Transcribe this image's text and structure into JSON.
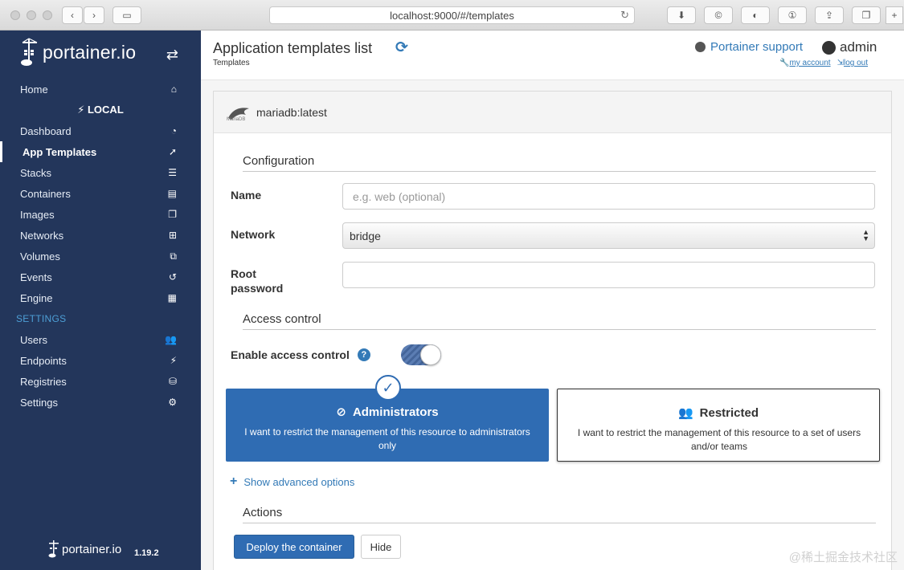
{
  "browser": {
    "url": "localhost:9000/#/templates"
  },
  "sidebar": {
    "logo_text": "portainer.io",
    "home_label": "Home",
    "endpoint_header": "LOCAL",
    "items": [
      {
        "label": "Dashboard",
        "icon": "tachometer-icon"
      },
      {
        "label": "App Templates",
        "icon": "rocket-icon",
        "active": true
      },
      {
        "label": "Stacks",
        "icon": "list-icon"
      },
      {
        "label": "Containers",
        "icon": "server-icon"
      },
      {
        "label": "Images",
        "icon": "clone-icon"
      },
      {
        "label": "Networks",
        "icon": "sitemap-icon"
      },
      {
        "label": "Volumes",
        "icon": "cubes-icon"
      },
      {
        "label": "Events",
        "icon": "history-icon"
      },
      {
        "label": "Engine",
        "icon": "th-icon"
      }
    ],
    "settings_header": "SETTINGS",
    "settings_items": [
      {
        "label": "Users",
        "icon": "users-icon"
      },
      {
        "label": "Endpoints",
        "icon": "plug-icon"
      },
      {
        "label": "Registries",
        "icon": "database-icon"
      },
      {
        "label": "Settings",
        "icon": "cogs-icon"
      }
    ],
    "footer_logo": "portainer.io",
    "version": "1.19.2"
  },
  "header": {
    "title": "Application templates list",
    "breadcrumb": "Templates",
    "support_label": "Portainer support",
    "username": "admin",
    "my_account": "my account",
    "log_out": "log out"
  },
  "template": {
    "name": "mariadb:latest",
    "logo_caption": "MariaDB"
  },
  "form": {
    "config_section": "Configuration",
    "name_label": "Name",
    "name_placeholder": "e.g. web (optional)",
    "network_label": "Network",
    "network_value": "bridge",
    "root_password_label_1": "Root",
    "root_password_label_2": "password",
    "access_section": "Access control",
    "enable_access_label": "Enable access control",
    "admin_title": "Administrators",
    "admin_desc": "I want to restrict the management of this resource to administrators only",
    "restricted_title": "Restricted",
    "restricted_desc": "I want to restrict the management of this resource to a set of users and/or teams",
    "advanced_label": "Show advanced options",
    "actions_section": "Actions",
    "deploy_label": "Deploy the container",
    "hide_label": "Hide"
  },
  "watermark": "@稀土掘金技术社区",
  "colors": {
    "sidebar_bg": "#23365b",
    "accent": "#2f6cb3",
    "link": "#337ab7"
  }
}
